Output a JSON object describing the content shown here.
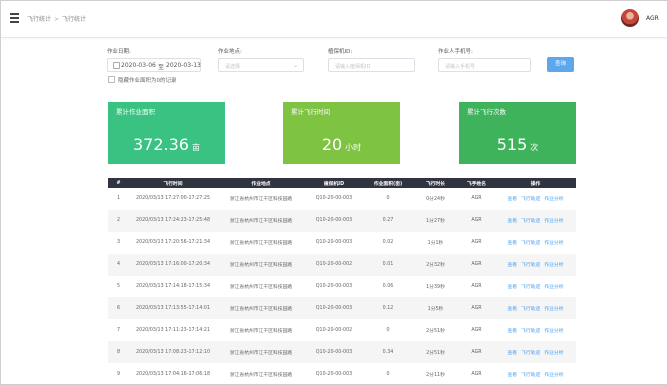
{
  "breadcrumb": {
    "parent": "飞行统计",
    "current": "飞行统计"
  },
  "user": {
    "name": "AGR"
  },
  "filters": {
    "date": {
      "label": "作业日期:",
      "start": "2020-03-06",
      "separator": "至",
      "end": "2020-03-13"
    },
    "location": {
      "label": "作业地点:",
      "placeholder": "请选择"
    },
    "drone": {
      "label": "植保机ID:",
      "placeholder": "请输入植保机ID"
    },
    "operator": {
      "label": "作业人手机号:",
      "placeholder": "请输入手机号"
    },
    "batch_checkbox": "隐藏作业面积为0的记录",
    "search_label": "查询"
  },
  "stats": [
    {
      "title": "累计作业面积",
      "value": "372.36",
      "unit": "亩",
      "color": "#3ac283"
    },
    {
      "title": "累计飞行时间",
      "value": "20",
      "unit": "小时",
      "color": "#7fc342"
    },
    {
      "title": "累计飞行次数",
      "value": "515",
      "unit": "次",
      "color": "#3fb25c"
    }
  ],
  "table": {
    "columns": [
      "#",
      "飞行时间",
      "作业地点",
      "植保机ID",
      "作业面积(亩)",
      "飞行时长",
      "飞手姓名",
      "操作"
    ],
    "actions": [
      "查看",
      "飞行轨迹",
      "作业分析"
    ],
    "rows": [
      {
        "idx": "1",
        "time": "2020/03/13 17:27:00-17:27:25",
        "place": "浙江省杭州市江干区科技园路",
        "id": "Q10-20-00-003",
        "area": "0",
        "duration": "0分24秒",
        "pilot": "AGR"
      },
      {
        "idx": "2",
        "time": "2020/03/13 17:24:23-17:25:48",
        "place": "浙江省杭州市江干区科技园路",
        "id": "Q10-20-00-003",
        "area": "0.27",
        "duration": "1分27秒",
        "pilot": "AGR"
      },
      {
        "idx": "3",
        "time": "2020/03/13 17:20:56-17:21:34",
        "place": "浙江省杭州市江干区科技园路",
        "id": "Q10-20-00-003",
        "area": "0.02",
        "duration": "1分1秒",
        "pilot": "AGR"
      },
      {
        "idx": "4",
        "time": "2020/03/13 17:16:00-17:20:34",
        "place": "浙江省杭州市江干区科技园路",
        "id": "Q10-20-00-002",
        "area": "0.01",
        "duration": "2分32秒",
        "pilot": "AGR"
      },
      {
        "idx": "5",
        "time": "2020/03/13 17:14:18-17:15:34",
        "place": "浙江省杭州市江干区科技园路",
        "id": "Q10-20-00-003",
        "area": "0.06",
        "duration": "1分39秒",
        "pilot": "AGR"
      },
      {
        "idx": "6",
        "time": "2020/03/13 17:13:55-17:14:01",
        "place": "浙江省杭州市江干区科技园路",
        "id": "Q10-20-00-003",
        "area": "0.12",
        "duration": "1分5秒",
        "pilot": "AGR"
      },
      {
        "idx": "7",
        "time": "2020/03/13 17:11:23-17:14:21",
        "place": "浙江省杭州市江干区科技园路",
        "id": "Q10-20-00-002",
        "area": "0",
        "duration": "2分51秒",
        "pilot": "AGR"
      },
      {
        "idx": "8",
        "time": "2020/03/13 17:08:23-17:12:10",
        "place": "浙江省杭州市江干区科技园路",
        "id": "Q10-20-00-003",
        "area": "0.34",
        "duration": "2分51秒",
        "pilot": "AGR"
      },
      {
        "idx": "9",
        "time": "2020/03/13 17:04:16-17:06:18",
        "place": "浙江省杭州市江干区科技园路",
        "id": "Q10-20-00-003",
        "area": "0",
        "duration": "2分11秒",
        "pilot": "AGR"
      }
    ]
  }
}
